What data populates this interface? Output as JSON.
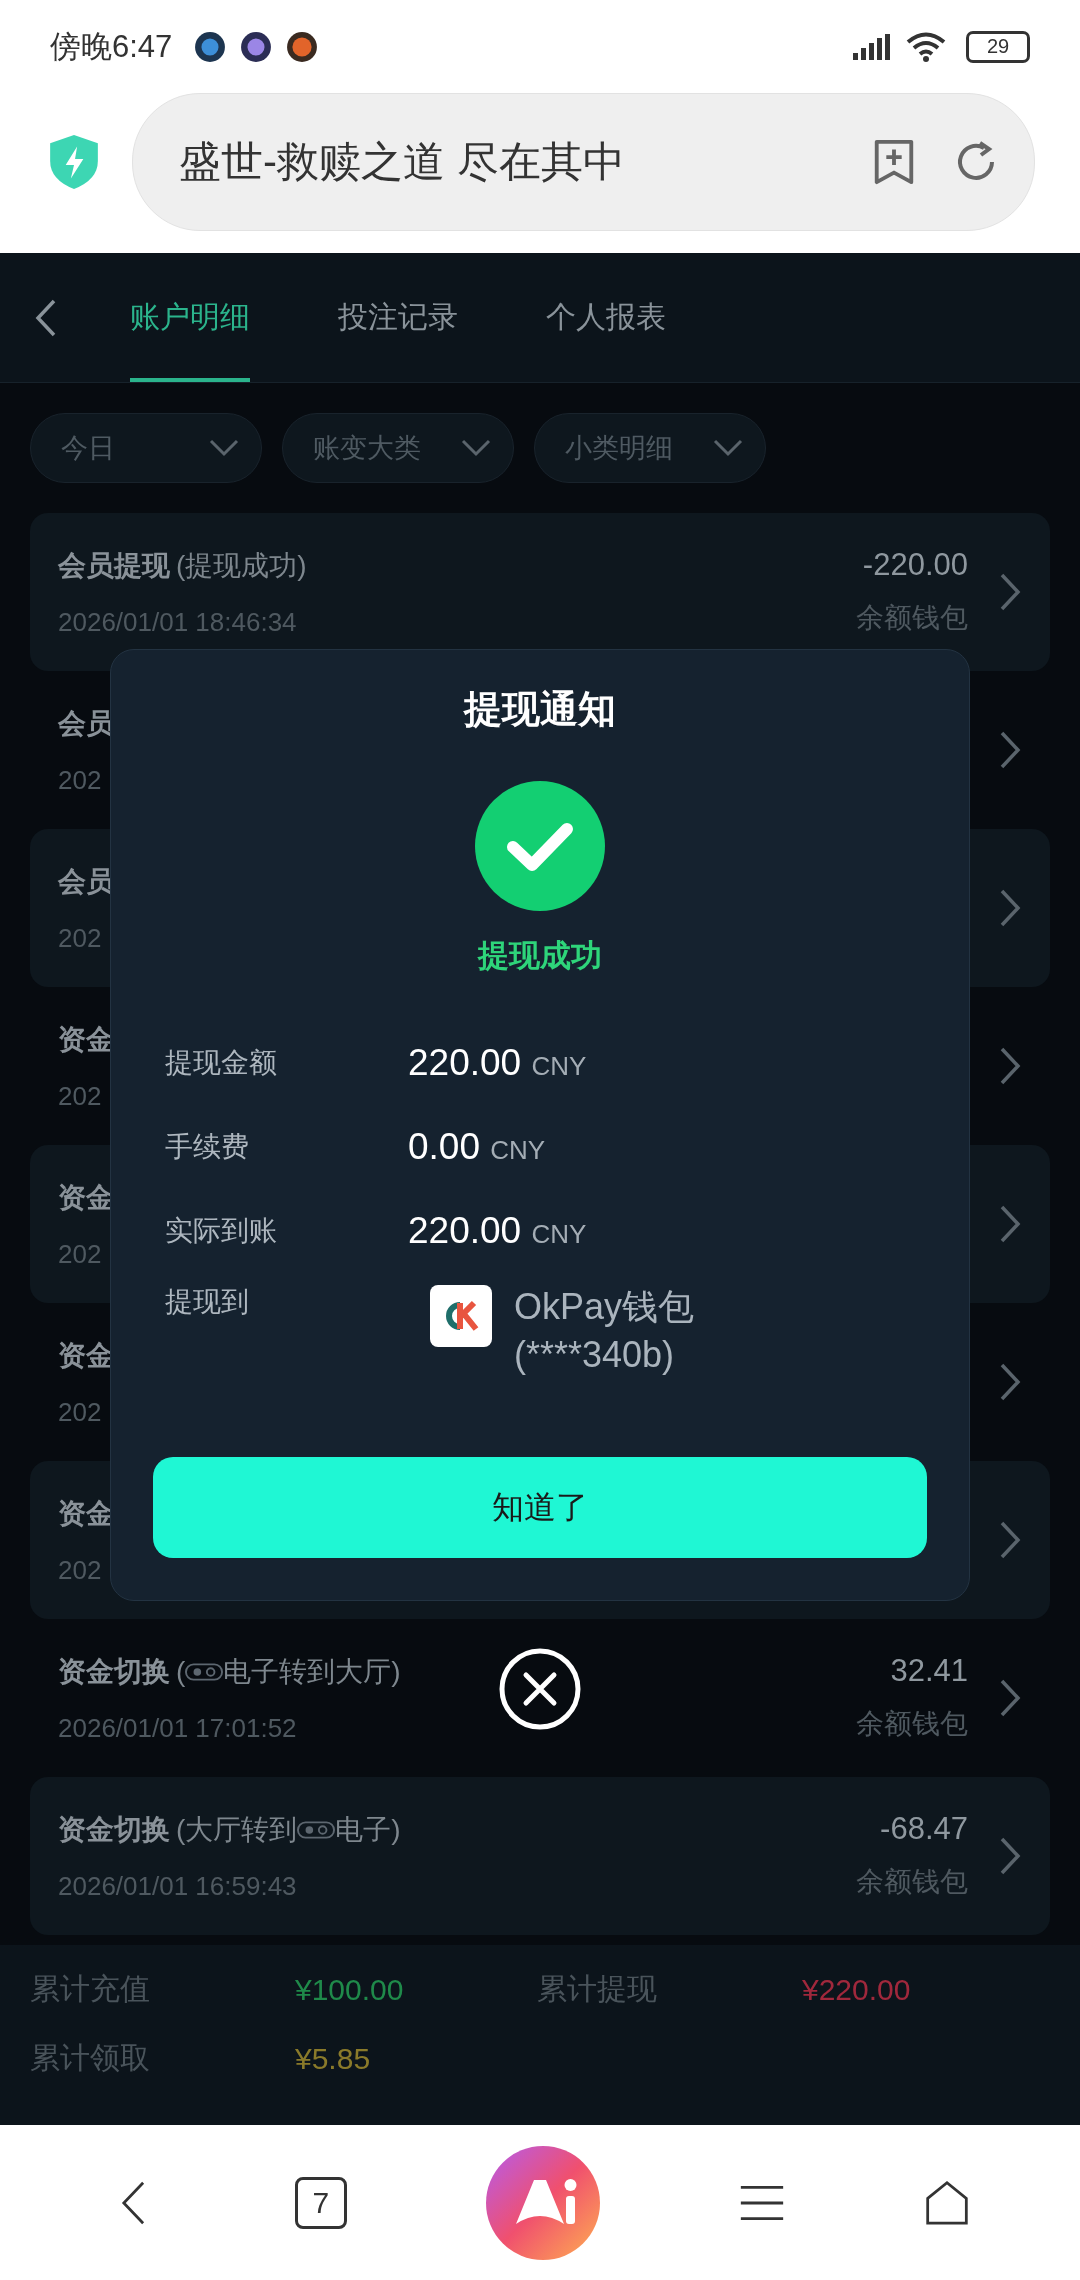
{
  "status_bar": {
    "time": "傍晚6:47",
    "battery": "29"
  },
  "address_bar": {
    "title": "盛世-救赎之道 尽在其中"
  },
  "tabs": [
    {
      "label": "账户明细",
      "selected": true
    },
    {
      "label": "投注记录",
      "selected": false
    },
    {
      "label": "个人报表",
      "selected": false
    }
  ],
  "filters": [
    {
      "label": "今日"
    },
    {
      "label": "账变大类"
    },
    {
      "label": "小类明细"
    }
  ],
  "records": [
    {
      "title": "会员提现",
      "note": [
        {
          "kind": "text",
          "text": "(提现成功)"
        }
      ],
      "time": "2026/01/01 18:46:34",
      "amount": "-220.00",
      "wallet": "余额钱包"
    },
    {
      "title": "会员",
      "time": "202"
    },
    {
      "title": "会员",
      "time": "202"
    },
    {
      "title": "资金",
      "time": "202"
    },
    {
      "title": "资金",
      "time": "202"
    },
    {
      "title": "资金",
      "time": "202"
    },
    {
      "title": "资金",
      "time": "202"
    },
    {
      "title": "资金切换",
      "note": [
        {
          "kind": "text",
          "text": "("
        },
        {
          "kind": "logo"
        },
        {
          "kind": "text",
          "text": "电子转到大厅)"
        }
      ],
      "time": "2026/01/01 17:01:52",
      "amount": "32.41",
      "wallet": "余额钱包"
    },
    {
      "title": "资金切换",
      "note": [
        {
          "kind": "text",
          "text": "(大厅转到"
        },
        {
          "kind": "logo"
        },
        {
          "kind": "text",
          "text": "电子)"
        }
      ],
      "time": "2026/01/01 16:59:43",
      "amount": "-68.47",
      "wallet": "余额钱包"
    }
  ],
  "summary": [
    {
      "label": "累计充值",
      "value": "¥100.00",
      "color": "#1f8a4a"
    },
    {
      "label": "累计提现",
      "value": "¥220.00",
      "color": "#a0283c"
    },
    {
      "label": "累计领取",
      "value": "¥5.85",
      "color": "#8a7a2a"
    }
  ],
  "dialog": {
    "title": "提现通知",
    "status": "提现成功",
    "details": [
      {
        "kind": "amount",
        "label": "提现金额",
        "value": "220.00",
        "unit": "CNY"
      },
      {
        "kind": "amount",
        "label": "手续费",
        "value": "0.00",
        "unit": "CNY"
      },
      {
        "kind": "amount",
        "label": "实际到账",
        "value": "220.00",
        "unit": "CNY"
      },
      {
        "kind": "wallet",
        "label": "提现到",
        "lines": [
          "OkPay钱包",
          "(****340b)"
        ]
      }
    ],
    "button": "知道了"
  },
  "bottom_nav": {
    "tab_count": "7"
  }
}
